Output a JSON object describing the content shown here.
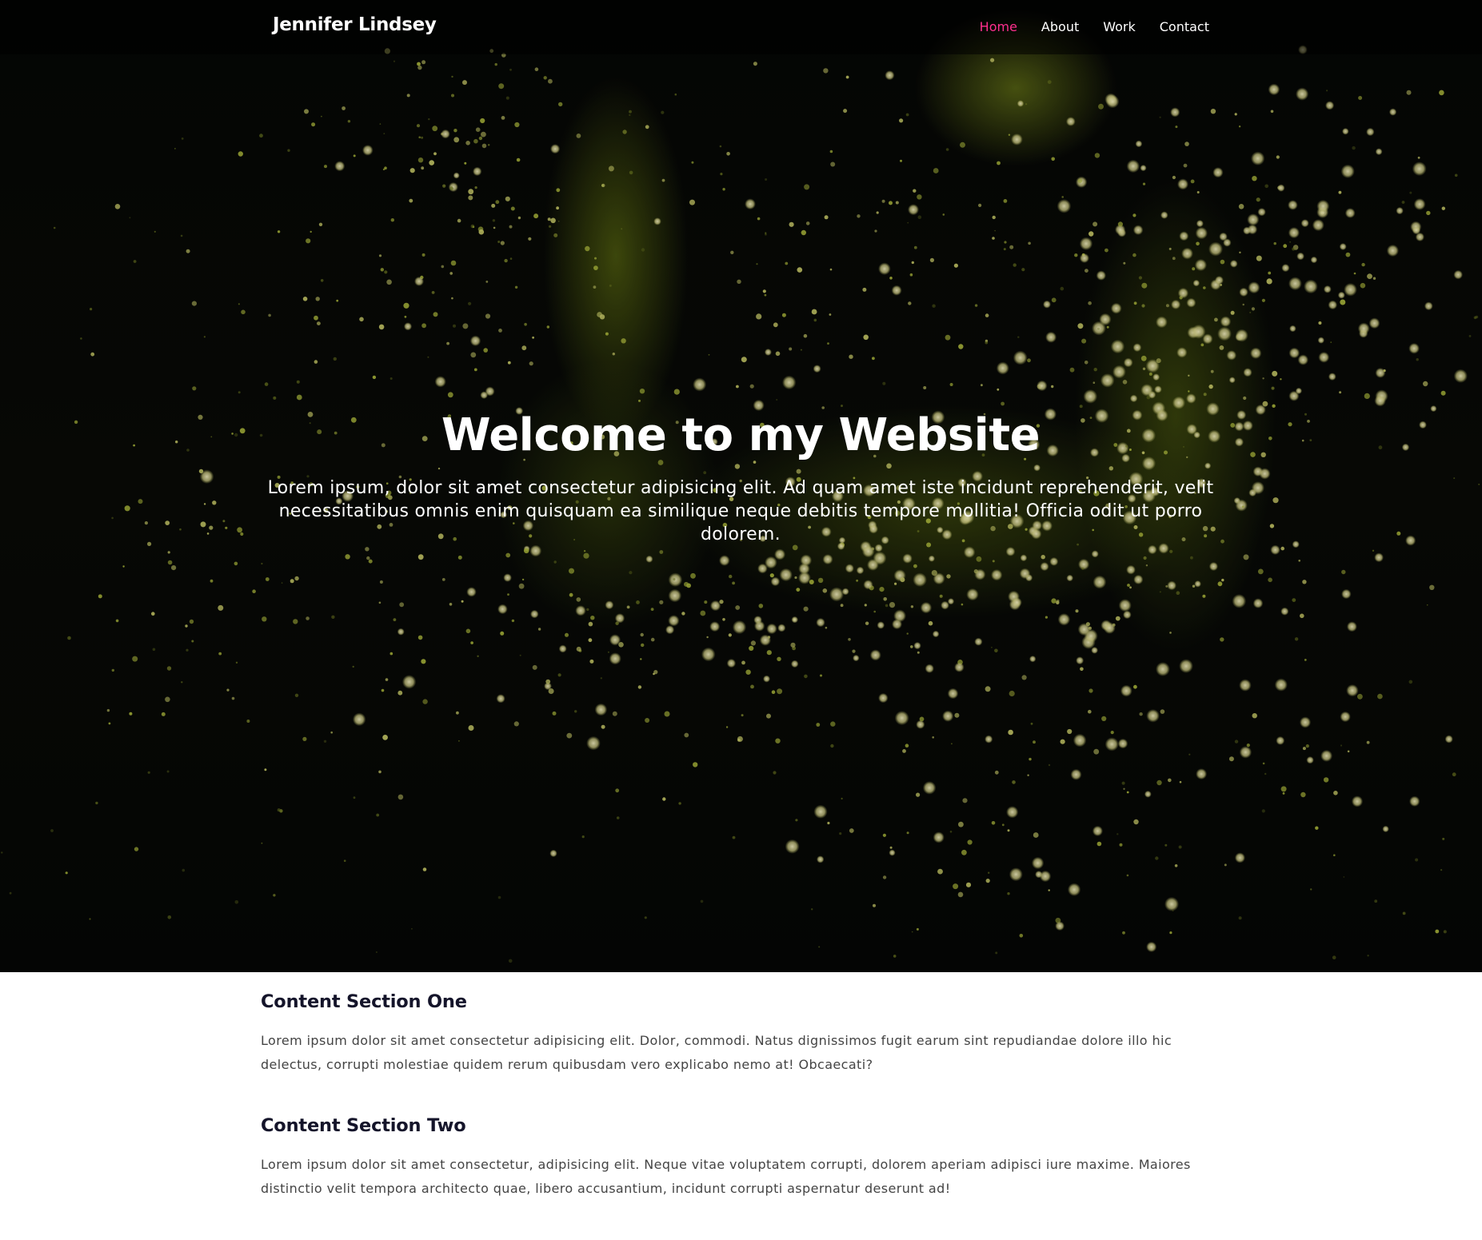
{
  "header": {
    "brand": "Jennifer Lindsey",
    "nav": [
      {
        "label": "Home",
        "active": true
      },
      {
        "label": "About",
        "active": false
      },
      {
        "label": "Work",
        "active": false
      },
      {
        "label": "Contact",
        "active": false
      }
    ]
  },
  "hero": {
    "title": "Welcome to my Website",
    "text": "Lorem ipsum, dolor sit amet consectetur adipisicing elit. Ad quam amet iste incidunt reprehenderit, velit necessitatibus omnis enim quisquam ea similique neque debitis tempore mollitia! Officia odit ut porro dolorem."
  },
  "sections": [
    {
      "title": "Content Section One",
      "text": "Lorem ipsum dolor sit amet consectetur adipisicing elit. Dolor, commodi. Natus dignissimos fugit earum sint repudiandae dolore illo hic delectus, corrupti molestiae quidem rerum quibusdam vero explicabo nemo at! Obcaecati?"
    },
    {
      "title": "Content Section Two",
      "text": "Lorem ipsum dolor sit amet consectetur, adipisicing elit. Neque vitae voluptatem corrupti, dolorem aperiam adipisci iure maxime. Maiores distinctio velit tempora architecto quae, libero accusantium, incidunt corrupti aspernatur deserunt ad!"
    }
  ],
  "colors": {
    "nav_active": "#ff2f8e",
    "nav_text": "#ffffff",
    "heading": "#14142a",
    "body_text": "#444444",
    "hero_glow": "#9aa71c"
  }
}
